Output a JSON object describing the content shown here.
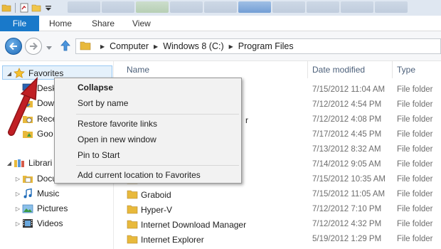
{
  "ribbon": {
    "tabs": [
      "File",
      "Home",
      "Share",
      "View"
    ]
  },
  "address": {
    "crumbs": [
      "Computer",
      "Windows 8 (C:)",
      "Program Files"
    ]
  },
  "columns": {
    "name": "Name",
    "date": "Date modified",
    "type": "Type"
  },
  "nav": {
    "favorites": "Favorites",
    "favorites_children": [
      "Desk",
      "Dow",
      "Rece",
      "Goo"
    ],
    "libraries": "Librari",
    "library_children": [
      "Docu",
      "Music",
      "Pictures",
      "Videos"
    ]
  },
  "files": [
    {
      "name": "",
      "date": "7/15/2012 11:04 AM",
      "type": "File folder"
    },
    {
      "name": "",
      "date": "7/12/2012 4:54 PM",
      "type": "File folder"
    },
    {
      "name": "r",
      "date": "7/12/2012 4:08 PM",
      "type": "File folder"
    },
    {
      "name": "",
      "date": "7/17/2012 4:45 PM",
      "type": "File folder"
    },
    {
      "name": "",
      "date": "7/13/2012 8:32 AM",
      "type": "File folder"
    },
    {
      "name": "",
      "date": "7/14/2012 9:05 AM",
      "type": "File folder"
    },
    {
      "name": "",
      "date": "7/15/2012 10:35 AM",
      "type": "File folder"
    },
    {
      "name": "Graboid",
      "date": "7/15/2012 11:05 AM",
      "type": "File folder"
    },
    {
      "name": "Hyper-V",
      "date": "7/12/2012 7:10 PM",
      "type": "File folder"
    },
    {
      "name": "Internet Download Manager",
      "date": "7/12/2012 4:32 PM",
      "type": "File folder"
    },
    {
      "name": "Internet Explorer",
      "date": "5/19/2012 1:29 PM",
      "type": "File folder"
    }
  ],
  "context_menu": {
    "items": [
      "Collapse",
      "Sort by name",
      "Restore favorite links",
      "Open in new window",
      "Pin to Start",
      "Add current location to Favorites"
    ]
  },
  "icons": {
    "back": "back-arrow-icon",
    "forward": "forward-arrow-icon",
    "up": "up-arrow-icon",
    "folder": "folder-icon",
    "star": "star-icon",
    "annotation": "red-arrow-annotation"
  },
  "colors": {
    "accent": "#1979ca",
    "selection": "#e5f1fb",
    "folder": "#e8b93c",
    "arrow": "#c01f24"
  }
}
